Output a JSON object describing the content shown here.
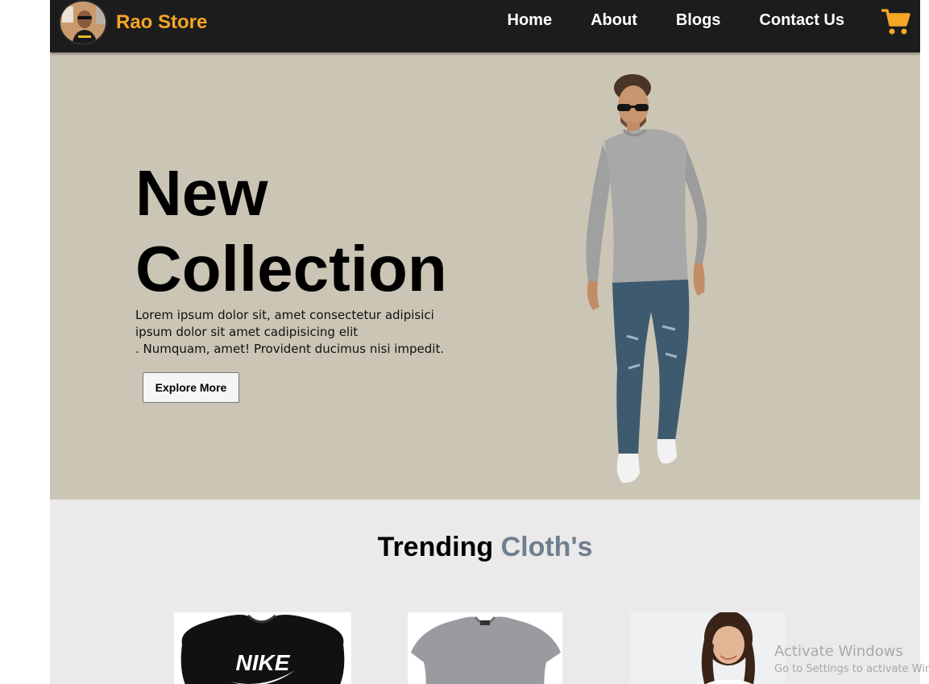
{
  "brand": {
    "name": "Rao Store",
    "accent": "#f5a623"
  },
  "nav": {
    "links": [
      {
        "label": "Home"
      },
      {
        "label": "About"
      },
      {
        "label": "Blogs"
      },
      {
        "label": "Contact Us"
      }
    ],
    "cart_icon": "shopping-cart-icon"
  },
  "hero": {
    "title_line1": "New",
    "title_line2": "Collection",
    "text_lines": [
      "Lorem ipsum dolor sit, amet consectetur adipisici",
      "ipsum dolor sit amet cadipisicing elit",
      ". Numquam, amet! Provident ducimus nisi impedit."
    ],
    "button_label": "Explore More",
    "background": "#cbc5b5"
  },
  "trending": {
    "title_part1": "Trending",
    "title_part2": "Cloth's",
    "accent": "#6f7f90",
    "products": [
      {
        "image": "black-nike-tshirt",
        "print": "NIKE"
      },
      {
        "image": "grey-tshirt"
      },
      {
        "image": "girl-model"
      }
    ]
  },
  "watermark": {
    "title": "Activate Windows",
    "subtitle": "Go to Settings to activate Windows."
  }
}
